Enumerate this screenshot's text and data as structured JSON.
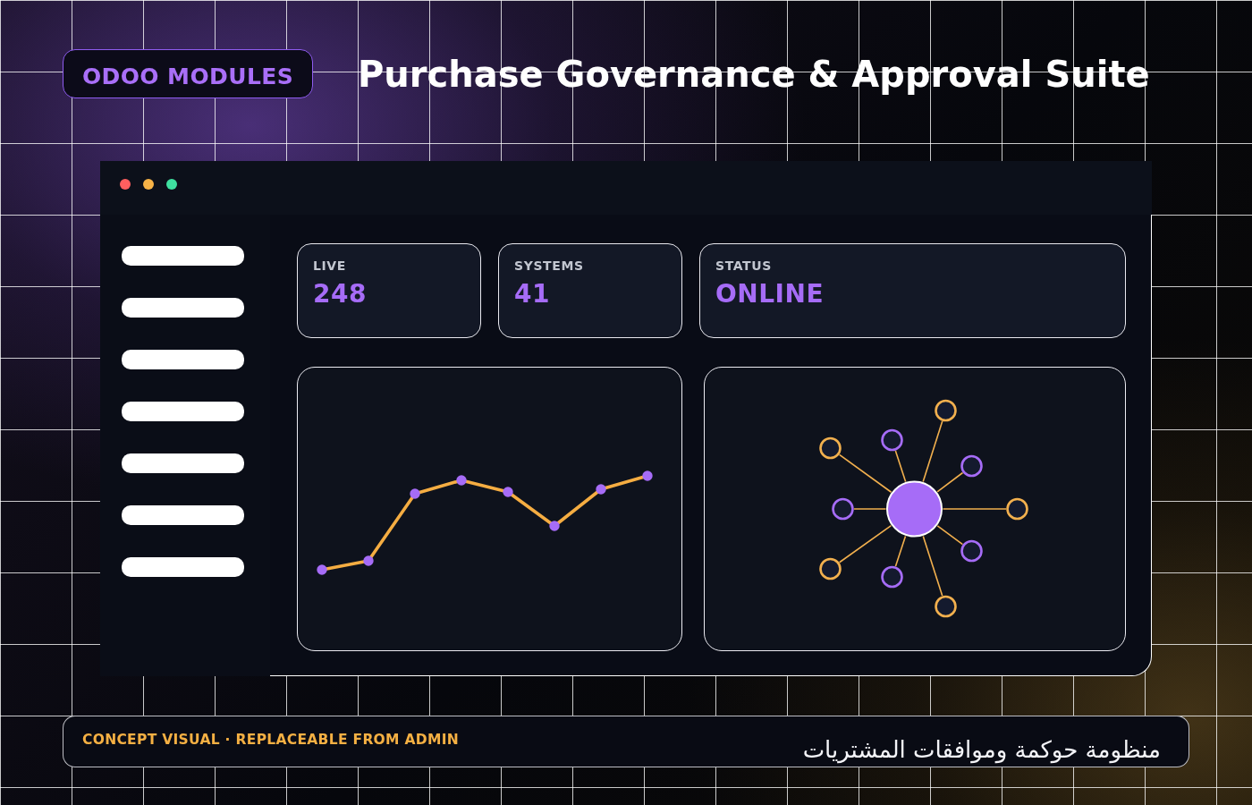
{
  "header": {
    "badge": "ODOO MODULES",
    "title": "Purchase Governance & Approval Suite"
  },
  "window": {
    "controls": [
      {
        "color": "#ff5f5f"
      },
      {
        "color": "#f7b347"
      },
      {
        "color": "#3fe0a0"
      }
    ]
  },
  "sidebar": {
    "items": [
      {
        "kind": "skeleton"
      },
      {
        "kind": "skeleton"
      },
      {
        "kind": "skeleton"
      },
      {
        "kind": "skeleton"
      },
      {
        "kind": "skeleton"
      },
      {
        "kind": "skeleton"
      },
      {
        "kind": "skeleton"
      }
    ]
  },
  "stats": [
    {
      "label": "LIVE",
      "value": "248"
    },
    {
      "label": "SYSTEMS",
      "value": "41"
    },
    {
      "label": "STATUS",
      "value": "ONLINE"
    }
  ],
  "panels": [
    {
      "kind": "line_chart"
    },
    {
      "kind": "network_diagram"
    }
  ],
  "footer": {
    "note": "CONCEPT VISUAL · REPLACEABLE FROM ADMIN",
    "tagline": "منظومة حوكمة وموافقات المشتريات"
  }
}
